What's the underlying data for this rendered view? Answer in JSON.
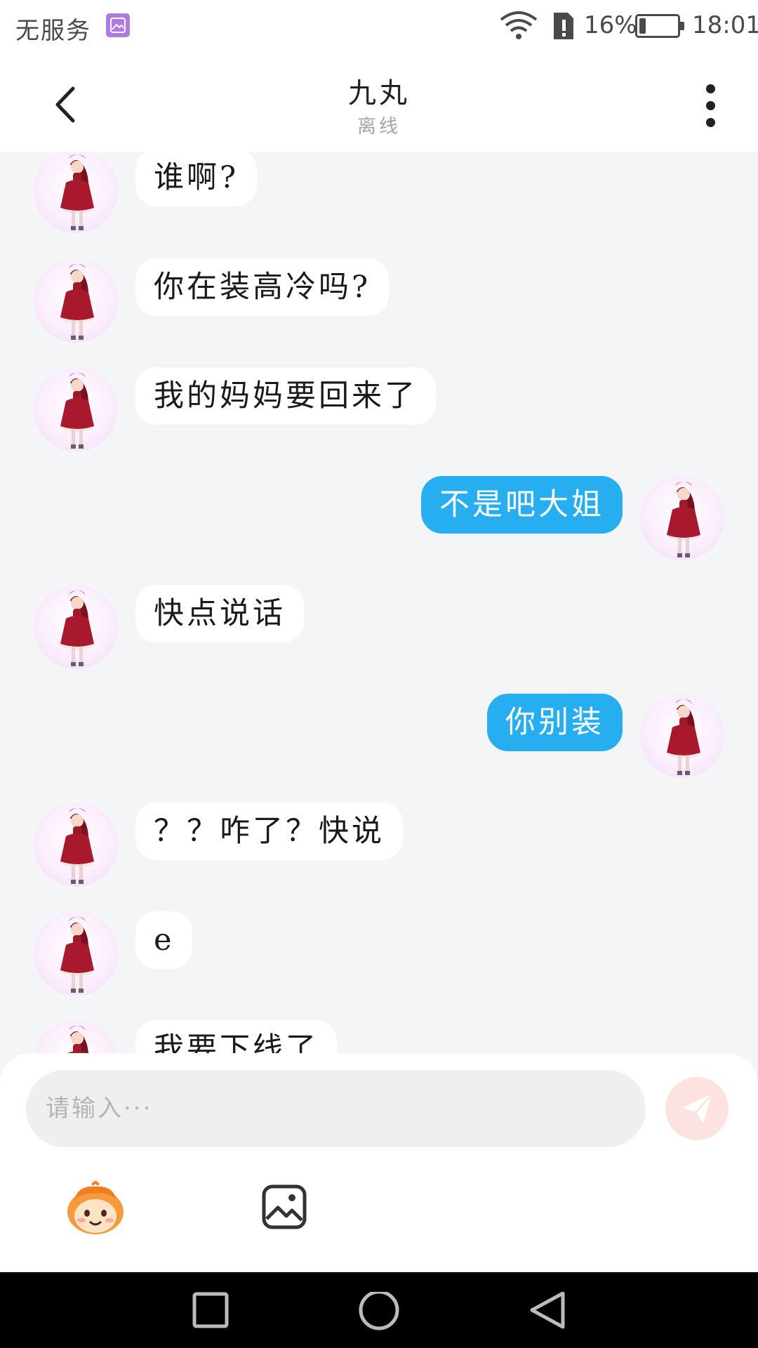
{
  "status_bar": {
    "carrier": "无服务",
    "battery_percent": "16%",
    "battery_level": 0.16,
    "time": "18:01"
  },
  "header": {
    "title": "九丸",
    "subtitle": "离线"
  },
  "messages": [
    {
      "side": "left",
      "text": "谁啊?"
    },
    {
      "side": "left",
      "text": "你在装高冷吗?"
    },
    {
      "side": "left",
      "text": "我的妈妈要回来了"
    },
    {
      "side": "right",
      "text": "不是吧大姐"
    },
    {
      "side": "left",
      "text": " 快点说话"
    },
    {
      "side": "right",
      "text": "你别装"
    },
    {
      "side": "left",
      "text": "？？咋了？快说"
    },
    {
      "side": "left",
      "text": "e"
    },
    {
      "side": "left",
      "text": "我要下线了"
    }
  ],
  "input": {
    "placeholder": "请输入···"
  },
  "colors": {
    "accent_blue": "#27aef0",
    "send_button_bg": "#fde3e0",
    "send_icon": "#f6b2a8",
    "chat_bg": "#f4f5f7"
  },
  "icons": {
    "back": "chevron-left-icon",
    "more": "more-vertical-icon",
    "send": "paper-plane-icon",
    "emoji": "emoji-face-icon",
    "image": "image-icon",
    "nav": [
      "square-icon",
      "circle-icon",
      "triangle-back-icon"
    ]
  }
}
